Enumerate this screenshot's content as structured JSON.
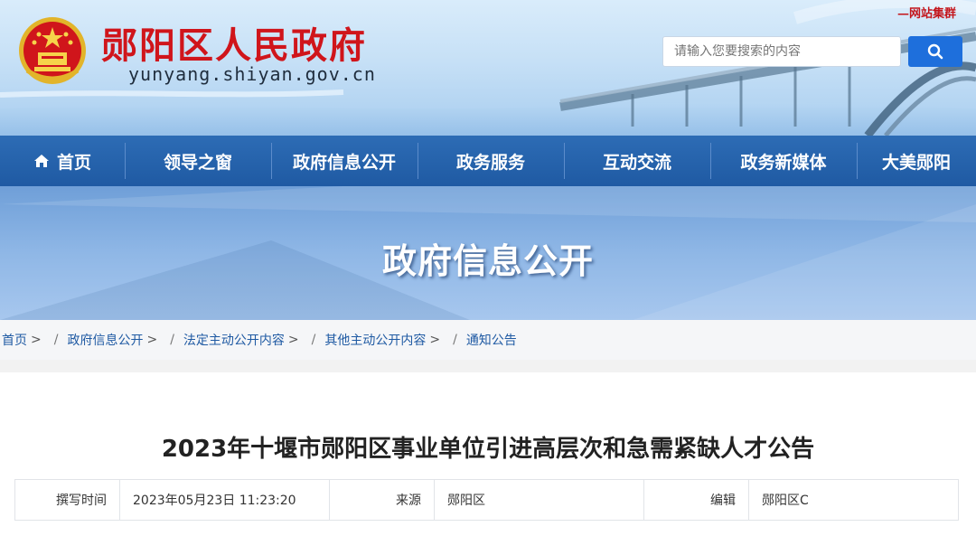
{
  "header": {
    "site_title": "郧阳区人民政府",
    "site_url": "yunyang.shiyan.gov.cn",
    "group_tag": "—网站集群",
    "search_placeholder": "请输入您要搜索的内容",
    "search_icon": "search-icon"
  },
  "nav": {
    "items": [
      {
        "label": "首页",
        "icon": "home-icon"
      },
      {
        "label": "领导之窗"
      },
      {
        "label": "政府信息公开"
      },
      {
        "label": "政务服务"
      },
      {
        "label": "互动交流"
      },
      {
        "label": "政务新媒体"
      },
      {
        "label": "大美郧阳"
      }
    ]
  },
  "banner": {
    "title": "政府信息公开"
  },
  "breadcrumb": {
    "items": [
      "首页",
      "政府信息公开",
      "法定主动公开内容",
      "其他主动公开内容",
      "通知公告"
    ],
    "separator": ">"
  },
  "article": {
    "title": "2023年十堰市郧阳区事业单位引进高层次和急需紧缺人才公告",
    "meta": {
      "time_label": "撰写时间",
      "time_value": "2023年05月23日 11:23:20",
      "source_label": "来源",
      "source_value": "郧阳区",
      "editor_label": "编辑",
      "editor_value": "郧阳区C"
    }
  },
  "colors": {
    "brand_red": "#d0151b",
    "nav_blue": "#1f5aa3",
    "search_blue": "#1e6fdc",
    "link_blue": "#1f5aa3"
  }
}
